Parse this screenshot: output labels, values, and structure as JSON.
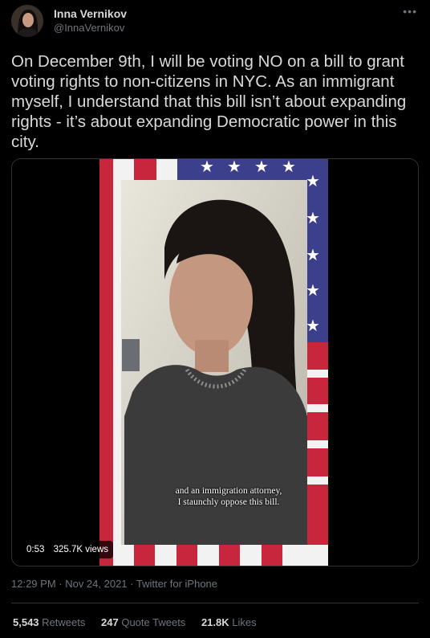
{
  "tweet": {
    "author_name": "Inna Vernikov",
    "author_handle": "@InnaVernikov",
    "more_icon": "more-horizontal-icon",
    "text": "On December 9th, I will be voting NO on a bill to grant voting rights to non-citizens in NYC. As an immigrant myself, I understand that this bill isn’t about expanding rights - it’s about expanding Democratic power in this city.",
    "timestamp": "12:29 PM · Nov 24, 2021 · Twitter for iPhone"
  },
  "video": {
    "caption_line1": "and an immigration attorney,",
    "caption_line2": "I staunchly oppose this bill.",
    "duration": "0:53",
    "views": "325.7K views"
  },
  "stats": {
    "retweets_count": "5,543",
    "retweets_label": "Retweets",
    "quotes_count": "247",
    "quotes_label": "Quote Tweets",
    "likes_count": "21.8K",
    "likes_label": "Likes"
  },
  "colors": {
    "background": "#000000",
    "text": "#d9d9d9",
    "muted": "#6e767d",
    "divider": "#2f3336",
    "flag_red": "#c8263d",
    "flag_blue": "#3b3f8c"
  }
}
